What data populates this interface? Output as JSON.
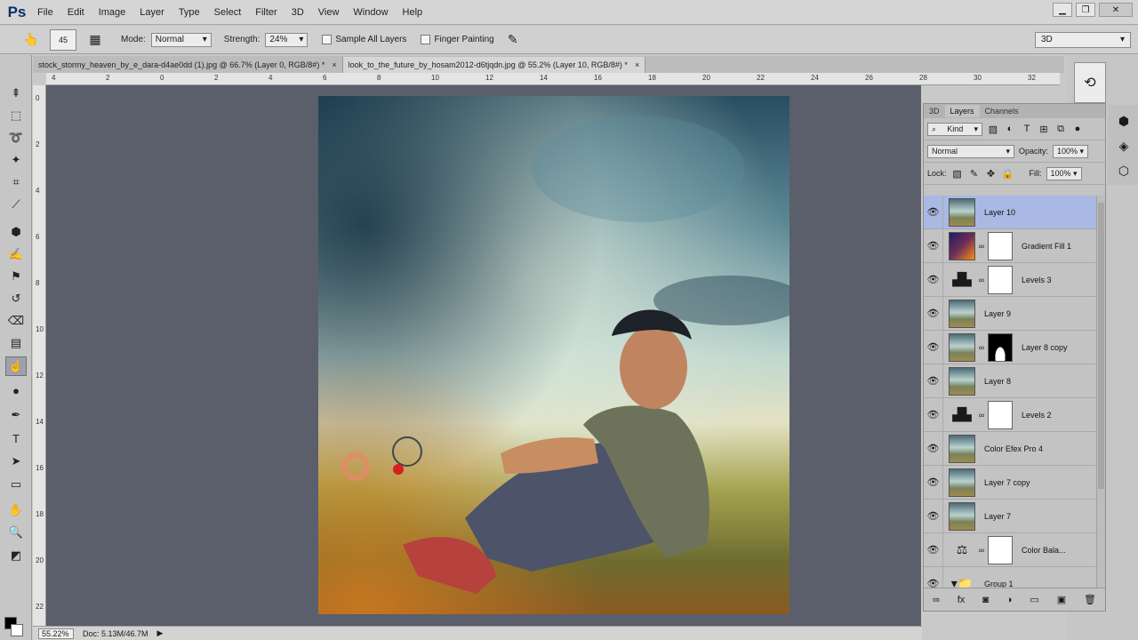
{
  "app": {
    "logo": "Ps"
  },
  "menu": [
    "File",
    "Edit",
    "Image",
    "Layer",
    "Type",
    "Select",
    "Filter",
    "3D",
    "View",
    "Window",
    "Help"
  ],
  "window_controls": [
    "▁",
    "❐",
    "✕"
  ],
  "options": {
    "tool_icon": "👆",
    "brush_size": "45",
    "mode_label": "Mode:",
    "mode_value": "Normal",
    "strength_label": "Strength:",
    "strength_value": "24%",
    "sample_all_layers": "Sample All Layers",
    "finger_painting": "Finger Painting",
    "right_value": "3D"
  },
  "documents": [
    {
      "title": "stock_stormy_heaven_by_e_dara-d4ae0dd (1).jpg @ 66.7% (Layer 0, RGB/8#) *",
      "close": "×"
    },
    {
      "title": "look_to_the_future_by_hosam2012-d6tjqdn.jpg @ 55.2% (Layer 10, RGB/8#) *",
      "close": "×"
    }
  ],
  "rulers": {
    "h_ticks": [
      "4",
      "2",
      "0",
      "2",
      "4",
      "6",
      "8",
      "10",
      "12",
      "14",
      "16",
      "18",
      "20",
      "22",
      "24",
      "26",
      "28",
      "30",
      "32"
    ],
    "v_ticks": [
      "0",
      "2",
      "4",
      "6",
      "8",
      "10",
      "12",
      "14",
      "16",
      "18",
      "20",
      "22"
    ]
  },
  "status": {
    "zoom": "55.22%",
    "doc_info": "Doc: 5.13M/46.7M",
    "arrow": "▶"
  },
  "layers_panel": {
    "tabs": [
      "3D",
      "Layers",
      "Channels"
    ],
    "kind_label": "Kind",
    "blend_mode": "Normal",
    "opacity_label": "Opacity:",
    "opacity_value": "100%",
    "lock_label": "Lock:",
    "fill_label": "Fill:",
    "fill_value": "100%",
    "layers": [
      {
        "name": "Layer 10",
        "thumb": "photo",
        "mask": "none",
        "selected": true
      },
      {
        "name": "Gradient Fill 1",
        "thumb": "gradient",
        "mask": "white",
        "selected": false
      },
      {
        "name": "Levels 3",
        "thumb": "levels",
        "mask": "white",
        "selected": false
      },
      {
        "name": "Layer 9",
        "thumb": "photo",
        "mask": "none",
        "selected": false
      },
      {
        "name": "Layer 8 copy",
        "thumb": "photo",
        "mask": "dark",
        "selected": false
      },
      {
        "name": "Layer 8",
        "thumb": "photo",
        "mask": "none",
        "selected": false
      },
      {
        "name": "Levels 2",
        "thumb": "levels",
        "mask": "white",
        "selected": false
      },
      {
        "name": "Color Efex Pro 4",
        "thumb": "photo",
        "mask": "none",
        "selected": false
      },
      {
        "name": "Layer 7 copy",
        "thumb": "photo",
        "mask": "none",
        "selected": false
      },
      {
        "name": "Layer 7",
        "thumb": "photo",
        "mask": "none",
        "selected": false
      },
      {
        "name": "Color Bala...",
        "thumb": "balance",
        "mask": "white",
        "selected": false
      },
      {
        "name": "Group 1",
        "thumb": "group",
        "mask": "none",
        "selected": false
      }
    ],
    "footer_icons": [
      "∞",
      "fx",
      "◙",
      "◑",
      "▭",
      "▣",
      "🗑"
    ]
  },
  "colors": {
    "canvas_bg": "#5b5e6b",
    "selected_layer": "#a9b9e3"
  }
}
